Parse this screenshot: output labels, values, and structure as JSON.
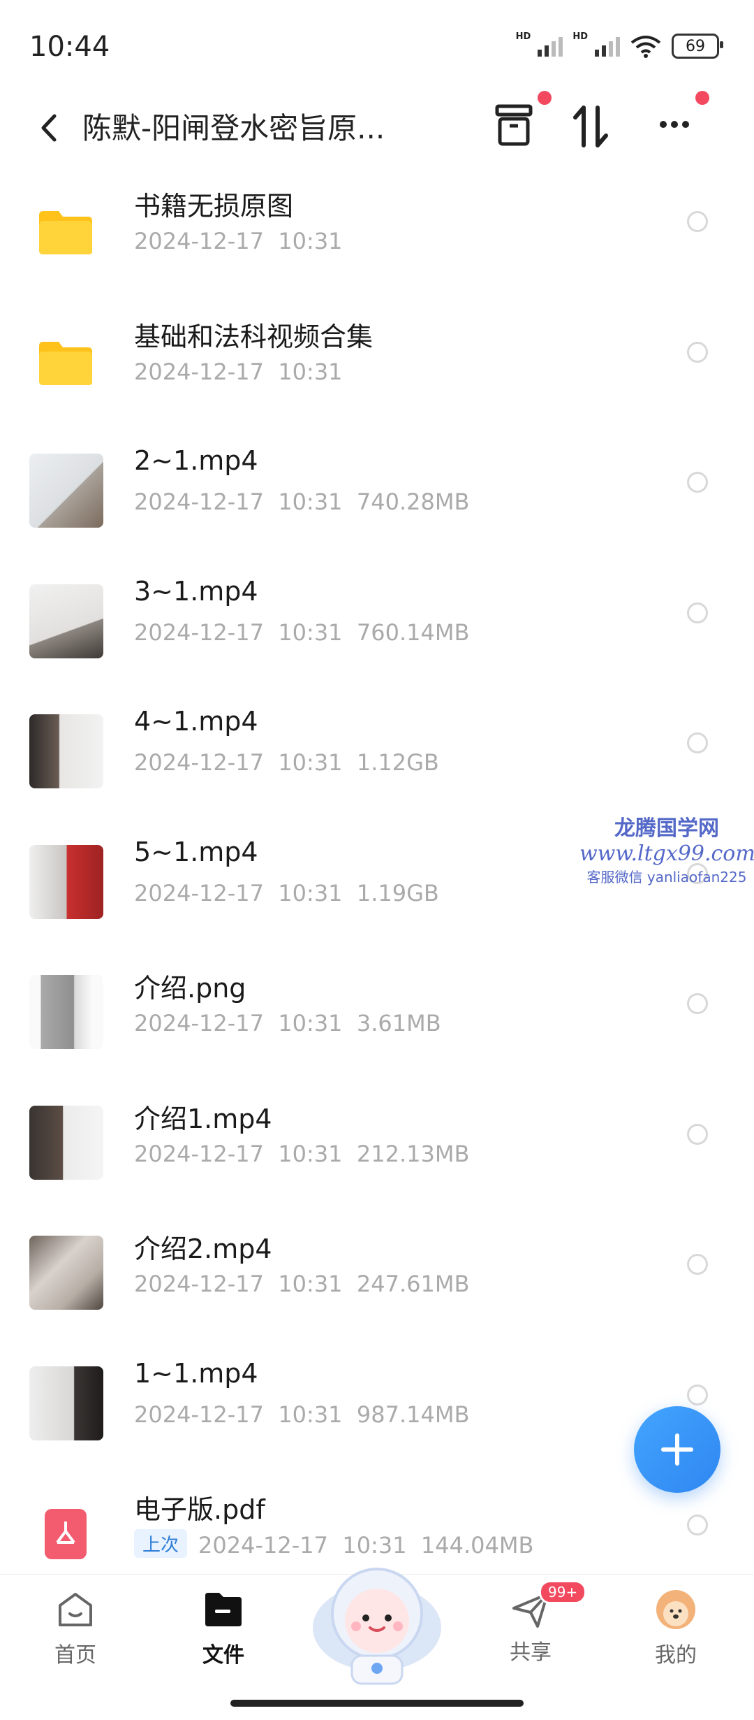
{
  "status": {
    "time": "10:44",
    "battery": "69",
    "hd1": "HD",
    "hd2": "HD"
  },
  "header": {
    "title": "陈默-阳闸登水密旨原..."
  },
  "files": [
    {
      "name": "书籍无损原图",
      "date": "2024-12-17",
      "time": "10:31",
      "size": "",
      "kind": "folder"
    },
    {
      "name": "基础和法科视频合集",
      "date": "2024-12-17",
      "time": "10:31",
      "size": "",
      "kind": "folder"
    },
    {
      "name": "2~1.mp4",
      "date": "2024-12-17",
      "time": "10:31",
      "size": "740.28MB",
      "kind": "video"
    },
    {
      "name": "3~1.mp4",
      "date": "2024-12-17",
      "time": "10:31",
      "size": "760.14MB",
      "kind": "video"
    },
    {
      "name": "4~1.mp4",
      "date": "2024-12-17",
      "time": "10:31",
      "size": "1.12GB",
      "kind": "video"
    },
    {
      "name": "5~1.mp4",
      "date": "2024-12-17",
      "time": "10:31",
      "size": "1.19GB",
      "kind": "video"
    },
    {
      "name": "介绍.png",
      "date": "2024-12-17",
      "time": "10:31",
      "size": "3.61MB",
      "kind": "image"
    },
    {
      "name": "介绍1.mp4",
      "date": "2024-12-17",
      "time": "10:31",
      "size": "212.13MB",
      "kind": "video"
    },
    {
      "name": "介绍2.mp4",
      "date": "2024-12-17",
      "time": "10:31",
      "size": "247.61MB",
      "kind": "video"
    },
    {
      "name": "1~1.mp4",
      "date": "2024-12-17",
      "time": "10:31",
      "size": "987.14MB",
      "kind": "video"
    },
    {
      "name": "电子版.pdf",
      "date": "2024-12-17",
      "time": "10:31",
      "size": "144.04MB",
      "kind": "pdf",
      "tag": "上次"
    }
  ],
  "watermark": {
    "line1": "龙腾国学网",
    "line2": "www.ltgx99.com",
    "line3": "客服微信 yanliaofan225"
  },
  "tabs": {
    "home": "首页",
    "files": "文件",
    "share": "共享",
    "mine": "我的",
    "share_badge": "99+"
  },
  "colors": {
    "accent": "#2f86f0",
    "badge": "#f2495f",
    "folder": "#ffd43b"
  }
}
